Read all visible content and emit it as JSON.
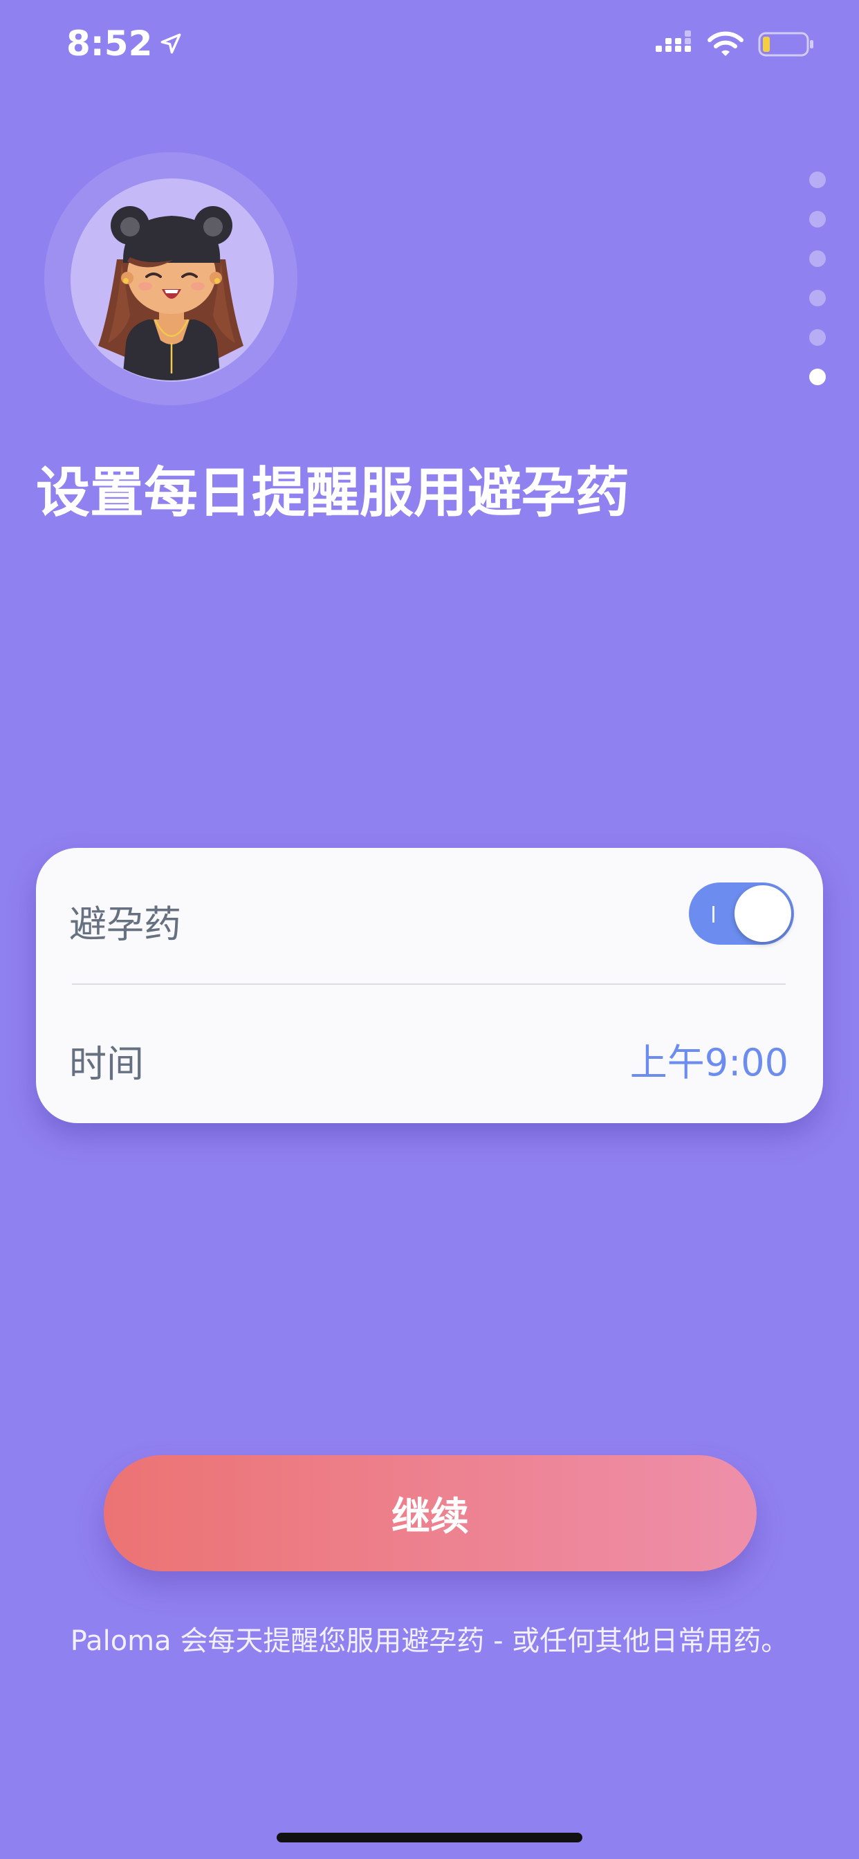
{
  "status_bar": {
    "time": "8:52"
  },
  "onboarding": {
    "total_pages": 6,
    "active_page": 6
  },
  "title": "设置每日提醒服用避孕药",
  "reminder_card": {
    "pill_label": "避孕药",
    "pill_toggle_on": true,
    "time_label": "时间",
    "time_value": "上午9:00"
  },
  "continue_button": {
    "label": "继续"
  },
  "footer_note": "Paloma 会每天提醒您服用避孕药 - 或任何其他日常用药。",
  "colors": {
    "background": "#9081F0",
    "accent_blue": "#6C8DEF",
    "button_gradient_start": "#EC7373",
    "button_gradient_end": "#EE8FAA"
  },
  "icons": [
    "location-arrow-icon",
    "cellular-signal-icon",
    "wifi-icon",
    "battery-icon"
  ]
}
